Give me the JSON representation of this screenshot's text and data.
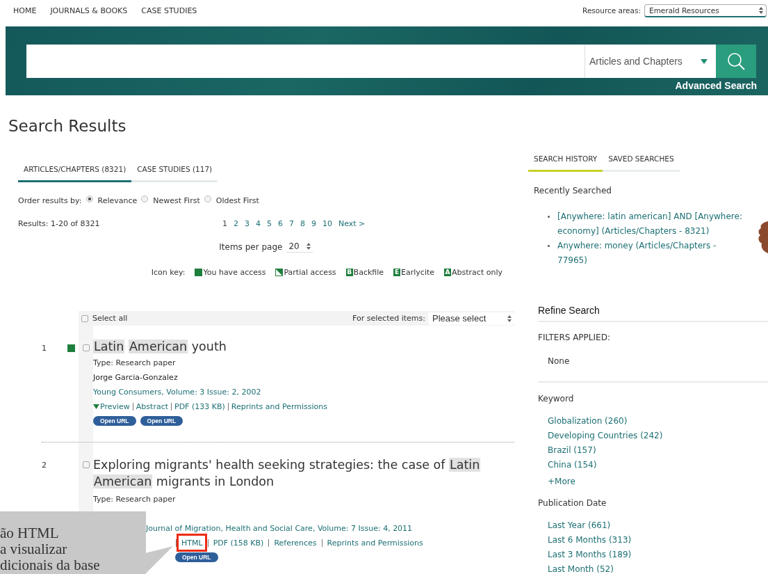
{
  "top_nav": {
    "links": [
      "HOME",
      "JOURNALS & BOOKS",
      "CASE STUDIES"
    ],
    "resource_areas": {
      "label": "Resource areas:",
      "value": "Emerald Resources"
    }
  },
  "search_bar": {
    "category": "Articles and Chapters",
    "advanced_link": "Advanced Search"
  },
  "page_title": "Search Results",
  "result_tabs": [
    {
      "label": "ARTICLES/CHAPTERS (8321)",
      "selected": true
    },
    {
      "label": "CASE STUDIES (117)",
      "selected": false
    }
  ],
  "order_by": {
    "label": "Order results by:",
    "options": [
      {
        "label": "Relevance",
        "selected": true
      },
      {
        "label": "Newest First",
        "selected": false
      },
      {
        "label": "Oldest First",
        "selected": false
      }
    ]
  },
  "results_summary": "Results: 1-20 of 8321",
  "pagination": {
    "pages": [
      {
        "label": "1",
        "selected": true
      },
      {
        "label": "2",
        "selected": false
      },
      {
        "label": "3",
        "selected": false
      },
      {
        "label": "4",
        "selected": false
      },
      {
        "label": "5",
        "selected": false
      },
      {
        "label": "6",
        "selected": false
      },
      {
        "label": "7",
        "selected": false
      },
      {
        "label": "8",
        "selected": false
      },
      {
        "label": "9",
        "selected": false
      },
      {
        "label": "10",
        "selected": false
      }
    ],
    "next": "Next >"
  },
  "items_per_page": {
    "label": "Items per page",
    "value": "20"
  },
  "icon_key": {
    "label": "Icon key:",
    "items": [
      {
        "kind": "full",
        "label": "You have access"
      },
      {
        "kind": "partial",
        "label": "Partial access"
      },
      {
        "kind": "letter",
        "letter": "B",
        "label": "Backfile"
      },
      {
        "kind": "letter",
        "letter": "E",
        "label": "Earlycite"
      },
      {
        "kind": "letter",
        "letter": "A",
        "label": "Abstract only"
      }
    ]
  },
  "select_bar": {
    "select_all": "Select all",
    "checked": false,
    "selected_items_label": "For selected items:",
    "action": "Please select"
  },
  "results": [
    {
      "number": "1",
      "access_icon": {
        "kind": "full"
      },
      "checked": false,
      "title_parts": [
        {
          "text": "Latin",
          "highlighted": true
        },
        {
          "text": "American",
          "highlighted": true
        },
        {
          "text": "youth",
          "highlighted": false
        }
      ],
      "type": "Type: Research paper",
      "author": "Jorge Garcia-Gonzalez",
      "source": "Young Consumers, Volume: 3 Issue: 2, 2002",
      "preview": "Preview",
      "links": [
        "Abstract",
        "PDF (133 KB)",
        "Reprints and Permissions"
      ],
      "buttons": [
        "Open URL",
        "Open URL"
      ],
      "obscured_left": false
    },
    {
      "number": "2",
      "checked": false,
      "title_parts": [
        {
          "text": "Exploring migrants' health seeking strategies: the case of",
          "highlighted": false
        },
        {
          "text": "Latin",
          "highlighted": true
        },
        {
          "text": "American",
          "highlighted": true
        },
        {
          "text": "migrants in London",
          "highlighted": false
        }
      ],
      "type": "Type: Research paper",
      "source": "Journal of Migration, Health and Social Care, Volume: 7 Issue: 4, 2011",
      "links": [
        "HTML",
        "PDF (158 KB)",
        "References",
        "Reprints and Permissions"
      ],
      "buttons": [
        "Open URL"
      ],
      "obscured_left": true
    }
  ],
  "history_tabs": [
    {
      "label": "SEARCH HISTORY",
      "selected": true
    },
    {
      "label": "SAVED SEARCHES",
      "selected": false
    }
  ],
  "recently_searched": {
    "heading": "Recently Searched",
    "items": [
      "[Anywhere: latin american] AND [Anywhere: economy] (Articles/Chapters - 8321)",
      "Anywhere: money (Articles/Chapters - 77965)"
    ]
  },
  "refine": {
    "title": "Refine Search",
    "filters_heading": "FILTERS APPLIED:",
    "filters_value": "None",
    "facets": [
      {
        "heading": "Keyword",
        "items": [
          "Globalization (260)",
          "Developing Countries (242)",
          "Brazil (157)",
          "China (154)"
        ],
        "more": "+More"
      },
      {
        "heading": "Publication Date",
        "items": [
          "Last Year (661)",
          "Last 6 Months (313)",
          "Last 3 Months (189)",
          "Last Month (52)"
        ]
      }
    ]
  },
  "annotation": {
    "callout_lines": [
      "ão HTML",
      "a visualizar",
      "dicionais da base"
    ],
    "highlight_box": true
  }
}
